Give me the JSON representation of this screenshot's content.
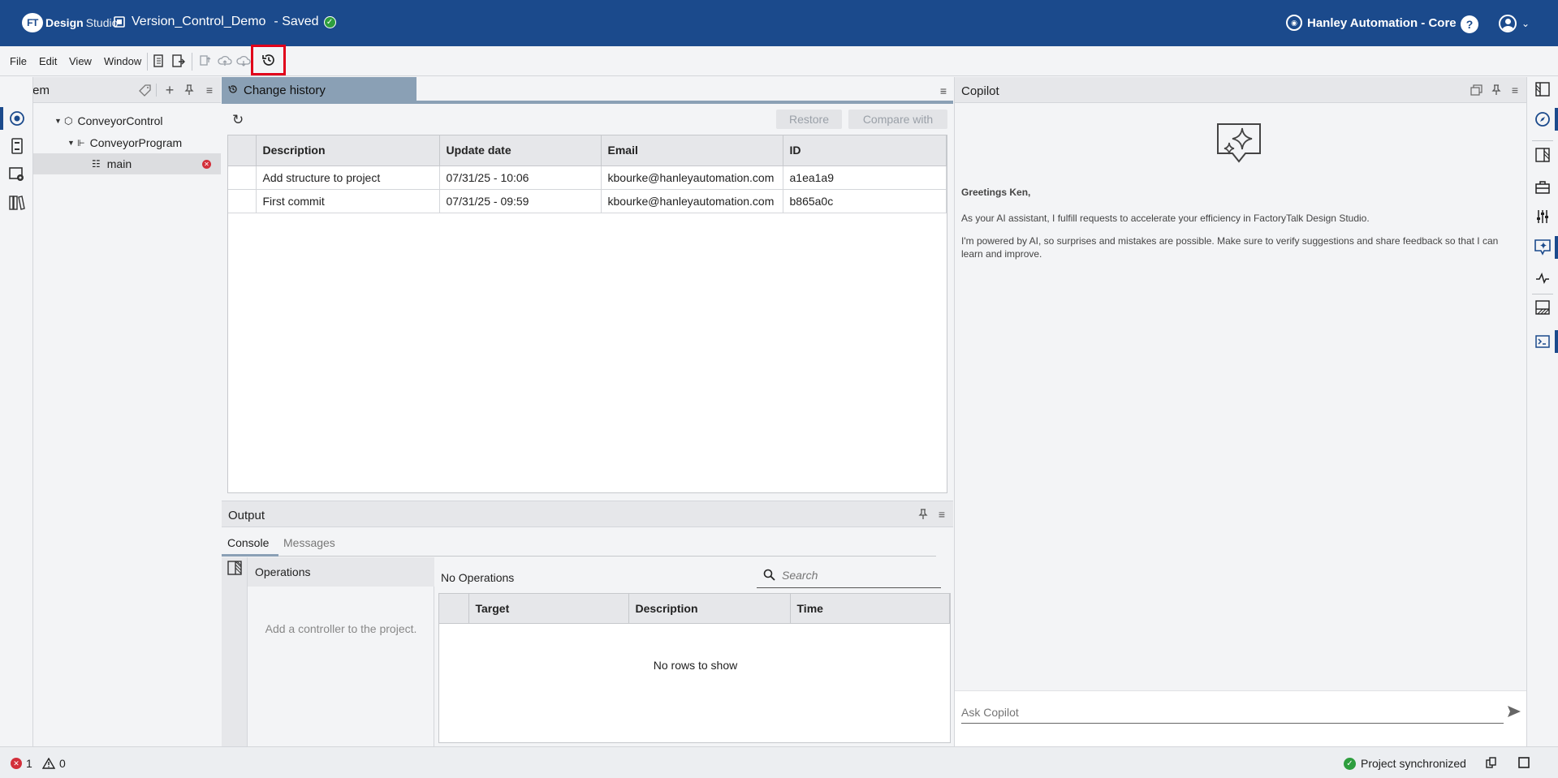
{
  "header": {
    "logo_badge": "FT",
    "logo_brand": "Design",
    "logo_product": "Studio",
    "project_name": "Version_Control_Demo",
    "save_status": "- Saved",
    "organization": "Hanley Automation - Core",
    "help_label": "?"
  },
  "menu": {
    "file": "File",
    "edit": "Edit",
    "view": "View",
    "window": "Window"
  },
  "system_panel": {
    "title": "System",
    "tree": [
      {
        "label": "ConveyorControl"
      },
      {
        "label": "ConveyorProgram"
      },
      {
        "label": "main"
      }
    ]
  },
  "change_history": {
    "tab_label": "Change history",
    "restore_label": "Restore",
    "compare_label": "Compare with",
    "columns": [
      "Description",
      "Update date",
      "Email",
      "ID"
    ],
    "rows": [
      {
        "description": "Add structure to project",
        "date": "07/31/25 - 10:06",
        "email": "kbourke@hanleyautomation.com",
        "id": "a1ea1a9"
      },
      {
        "description": "First commit",
        "date": "07/31/25 - 09:59",
        "email": "kbourke@hanleyautomation.com",
        "id": "b865a0c"
      }
    ]
  },
  "output": {
    "title": "Output",
    "tabs": [
      "Console",
      "Messages"
    ],
    "operations_title": "Operations",
    "operations_empty": "Add a controller to the project.",
    "no_operations": "No Operations",
    "search_placeholder": "Search",
    "columns": [
      "Target",
      "Description",
      "Time"
    ],
    "no_rows": "No rows to show"
  },
  "copilot": {
    "title": "Copilot",
    "greeting": "Greetings Ken,",
    "intro": "As your AI assistant, I fulfill requests to accelerate your efficiency in FactoryTalk Design Studio.",
    "disclaimer": "I'm powered by AI, so surprises and mistakes are possible. Make sure to verify suggestions and share feedback so that I can learn and improve.",
    "input_placeholder": "Ask Copilot"
  },
  "status_bar": {
    "error_count": "1",
    "warning_count": "0",
    "sync_status": "Project synchronized"
  },
  "colors": {
    "header_bg": "#1b4a8c",
    "highlight": "#e0001b",
    "success": "#2e9e3e",
    "error": "#d32f3a"
  }
}
